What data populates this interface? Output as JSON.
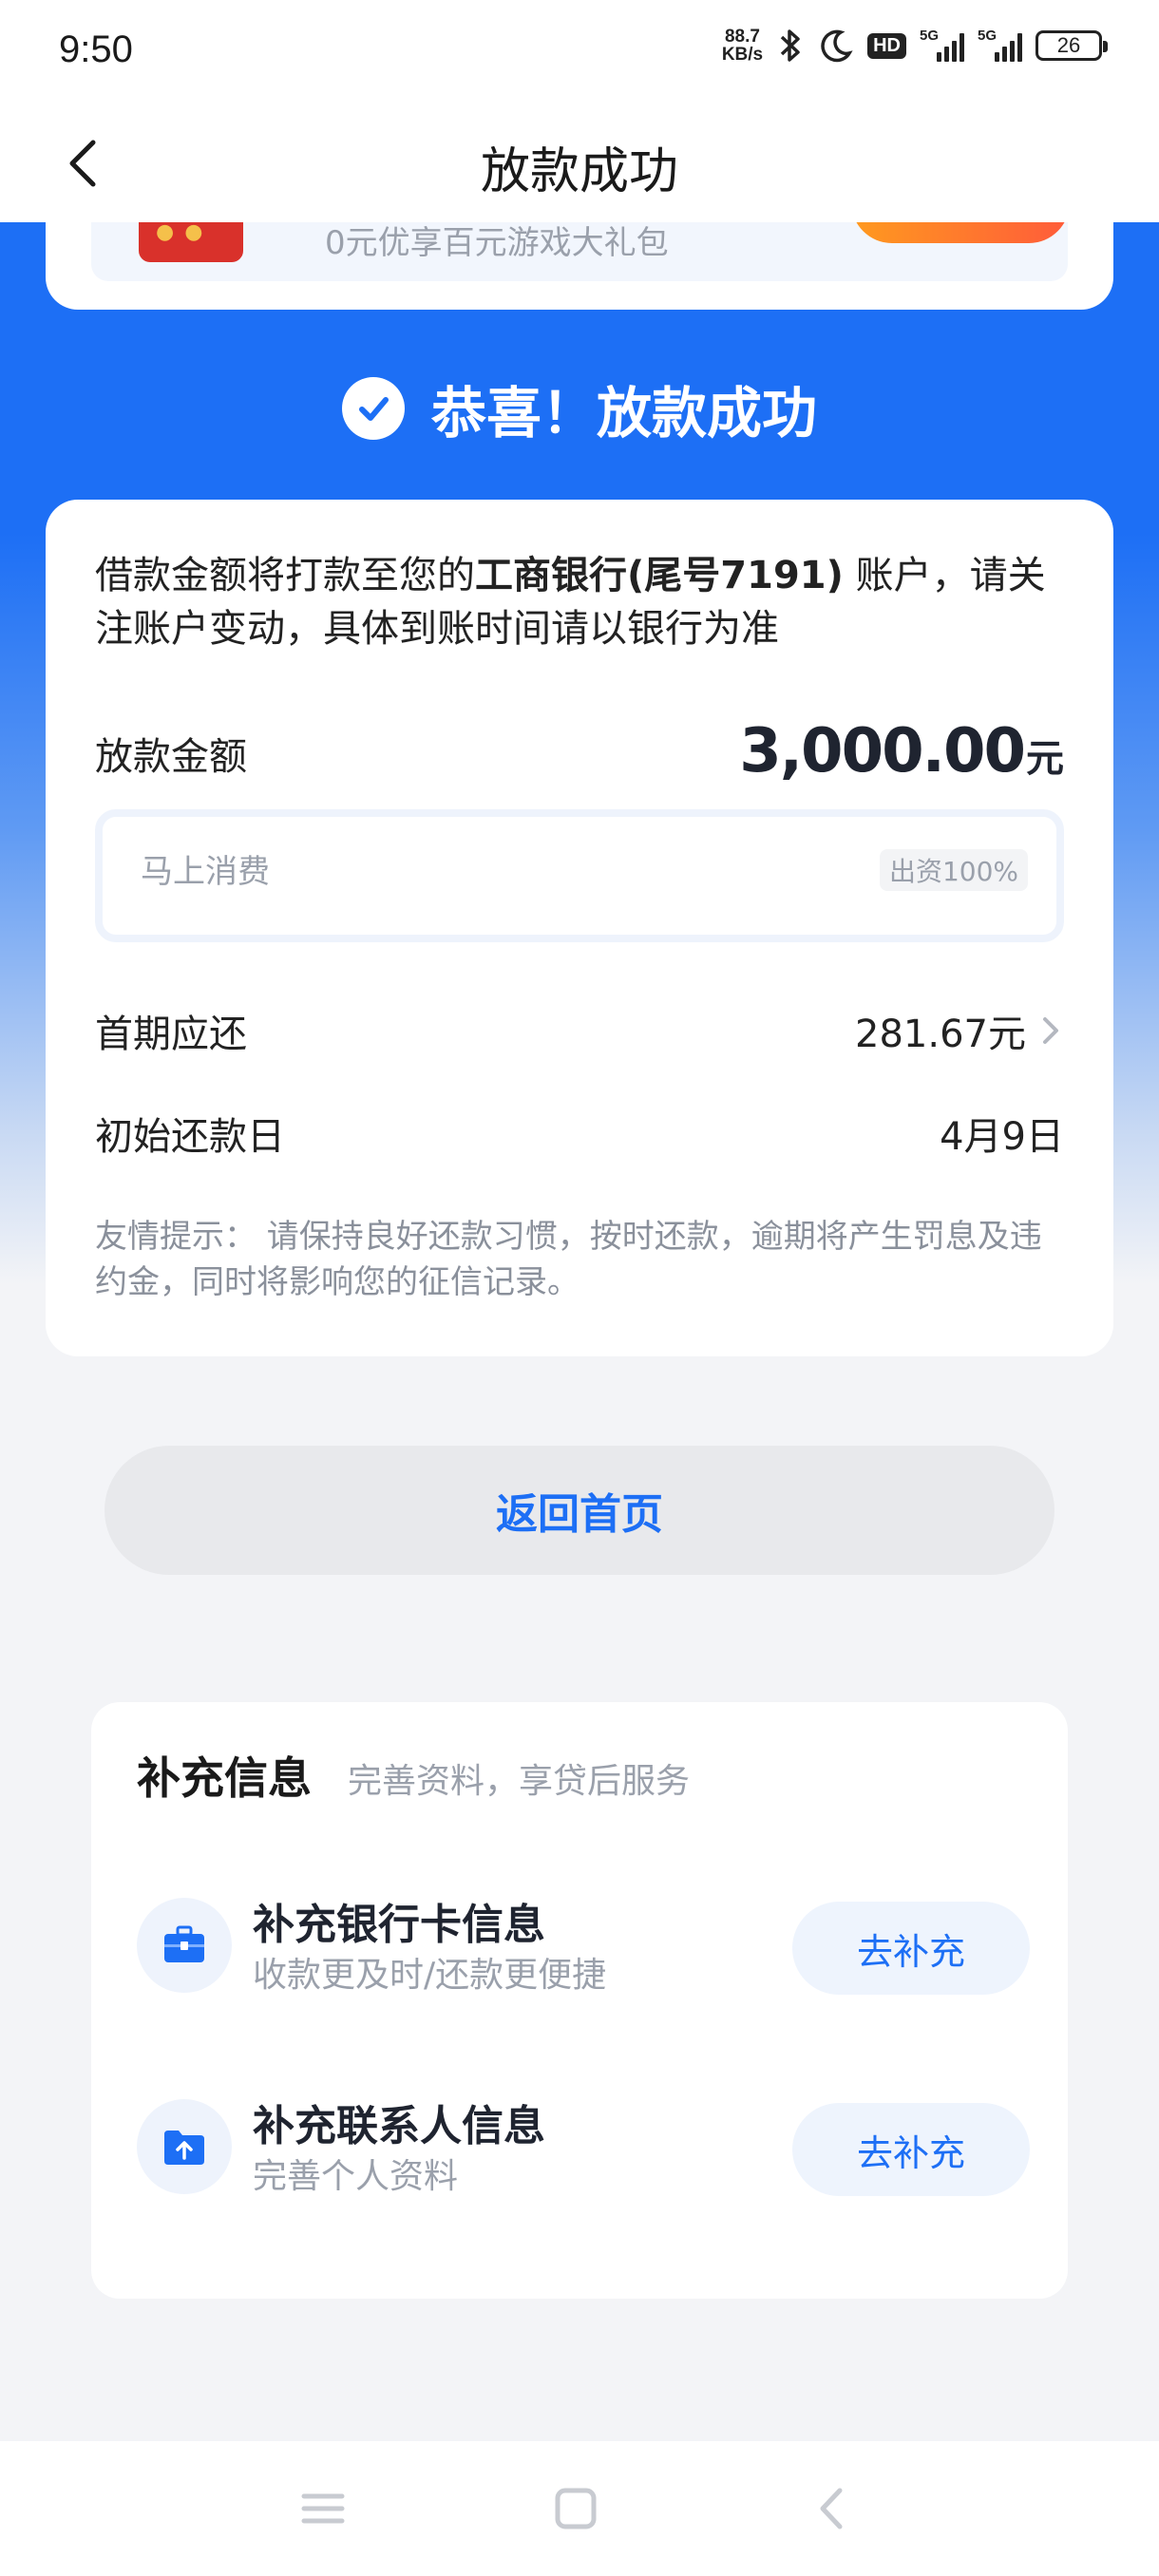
{
  "status_bar": {
    "time": "9:50",
    "net_speed_value": "88.7",
    "net_speed_unit": "KB/s",
    "hd_label": "HD",
    "signal1_label": "5G",
    "signal2_label": "5G",
    "battery": "26"
  },
  "nav": {
    "title": "放款成功"
  },
  "promo": {
    "text": "0元优享百元游戏大礼包"
  },
  "success": {
    "message": "恭喜！放款成功"
  },
  "info": {
    "notice_prefix": "借款金额将打款至您的",
    "notice_bank": "工商银行(尾号7191)",
    "notice_suffix": " 账户，请关注账户变动，具体到账时间请以银行为准",
    "amount_label": "放款金额",
    "amount_value": "3,000.00",
    "amount_unit": "元",
    "fund_name": "马上消费",
    "fund_badge": "出资100%",
    "first_repay_label": "首期应还",
    "first_repay_value": "281.67元",
    "start_date_label": "初始还款日",
    "start_date_value": "4月9日",
    "tip": "友情提示：  请保持良好还款习惯，按时还款，逾期将产生罚息及违约金，同时将影响您的征信记录。"
  },
  "home_button": "返回首页",
  "supplement": {
    "title": "补充信息",
    "subtitle": "完善资料，享贷后服务",
    "items": [
      {
        "title": "补充银行卡信息",
        "desc": "收款更及时/还款更便捷",
        "button": "去补充",
        "icon": "briefcase-icon"
      },
      {
        "title": "补充联系人信息",
        "desc": "完善个人资料",
        "button": "去补充",
        "icon": "folder-upload-icon"
      }
    ]
  },
  "colors": {
    "brand_blue": "#1d6ff5",
    "promo_orange": "#ff7a2a"
  }
}
